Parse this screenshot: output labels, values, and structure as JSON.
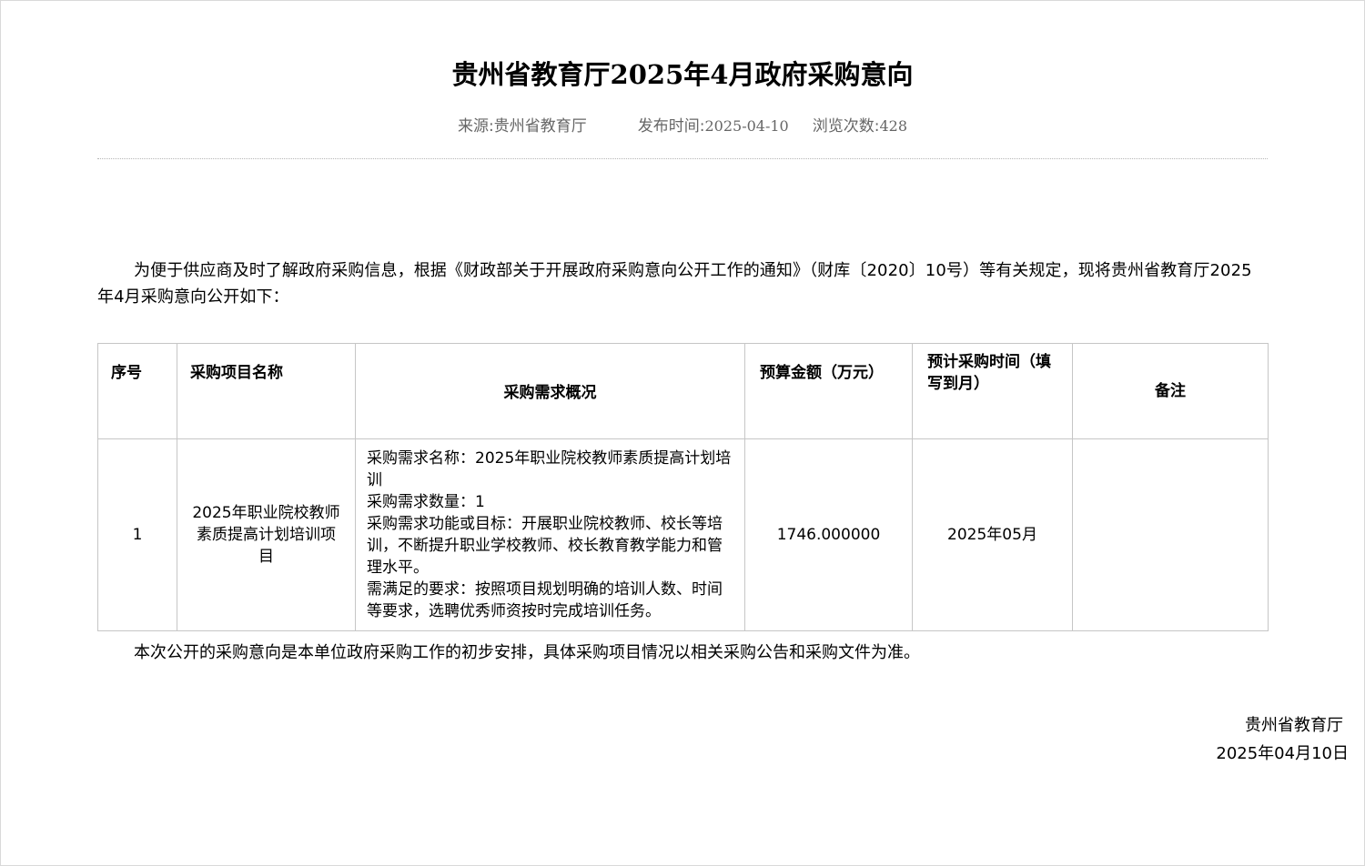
{
  "article": {
    "title": "贵州省教育厅2025年4月政府采购意向",
    "meta": {
      "source_label": "来源:",
      "source_value": "贵州省教育厅",
      "publish_label": "发布时间:",
      "publish_value": "2025-04-10",
      "views_label": "浏览次数:",
      "views_value": "428"
    },
    "intro": "为便于供应商及时了解政府采购信息，根据《财政部关于开展政府采购意向公开工作的通知》（财库〔2020〕10号）等有关规定，现将贵州省教育厅2025年4月采购意向公开如下：",
    "table": {
      "headers": {
        "seq": "序号",
        "name": "采购项目名称",
        "desc": "采购需求概况",
        "budget": "预算金额（万元）",
        "time": "预计采购时间（填写到月）",
        "remark": "备注"
      },
      "rows": [
        {
          "seq": "1",
          "name": "2025年职业院校教师素质提高计划培训项目",
          "desc": [
            "采购需求名称：2025年职业院校教师素质提高计划培训",
            "采购需求数量：1",
            "采购需求功能或目标：开展职业院校教师、校长等培训，不断提升职业学校教师、校长教育教学能力和管理水平。",
            "需满足的要求：按照项目规划明确的培训人数、时间等要求，选聘优秀师资按时完成培训任务。"
          ],
          "budget": "1746.000000",
          "time": "2025年05月",
          "remark": ""
        }
      ]
    },
    "closing": "本次公开的采购意向是本单位政府采购工作的初步安排，具体采购项目情况以相关采购公告和采购文件为准。",
    "signature": {
      "org": "贵州省教育厅",
      "date": "2025年04月10日"
    }
  }
}
